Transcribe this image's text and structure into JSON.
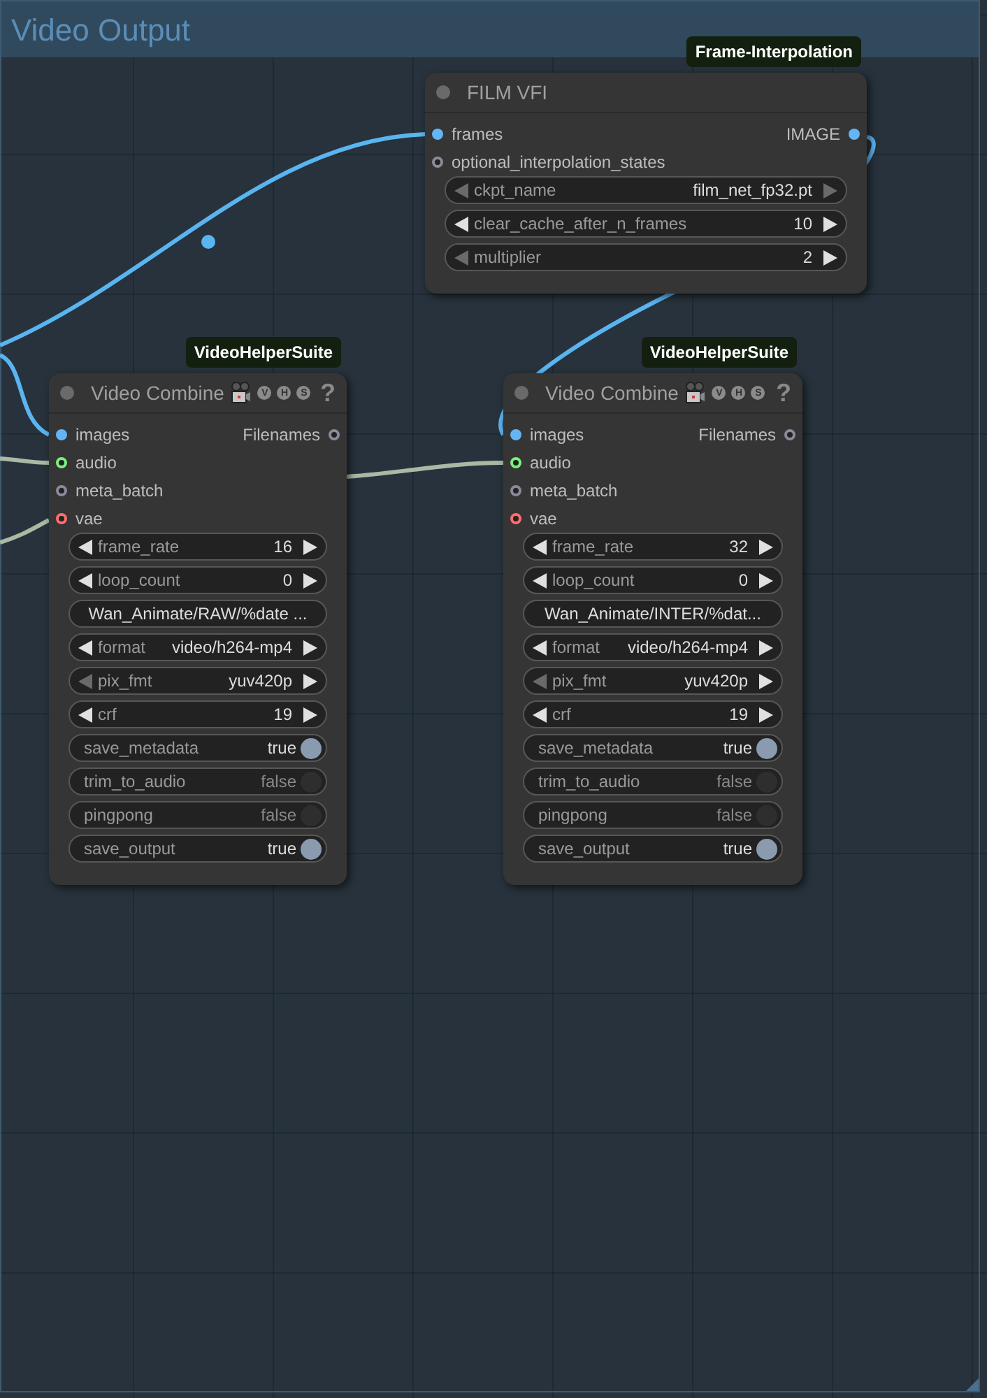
{
  "group": {
    "title": "Video Output"
  },
  "links": [
    {
      "color": "#5ab4f0"
    },
    {
      "color": "#5ab4f0"
    },
    {
      "color": "#5ab4f0"
    },
    {
      "color": "#a9b9a4"
    },
    {
      "color": "#a9b9a4"
    },
    {
      "color": "#a9b9a4"
    }
  ],
  "nodes": [
    {
      "badge": "Frame-Interpolation",
      "title": "FILM VFI",
      "camera": false,
      "inputs": [
        {
          "name": "frames",
          "color": "#64b5f6",
          "connected": true
        },
        {
          "name": "optional_interpolation_states",
          "color": "#8a8a9a",
          "connected": false
        }
      ],
      "outputs": [
        {
          "name": "IMAGE",
          "color": "#64b5f6",
          "connected": true
        }
      ],
      "widgets": [
        {
          "kind": "combo",
          "label": "ckpt_name",
          "value": "film_net_fp32.pt",
          "prev_enabled": false,
          "next_enabled": false
        },
        {
          "kind": "number",
          "label": "clear_cache_after_n_frames",
          "value": "10",
          "prev_enabled": true,
          "next_enabled": true
        },
        {
          "kind": "number",
          "label": "multiplier",
          "value": "2",
          "prev_enabled": false,
          "next_enabled": true
        }
      ]
    },
    {
      "badge": "VideoHelperSuite",
      "title": "Video Combine",
      "camera": true,
      "header_icons": [
        "V",
        "H",
        "S"
      ],
      "help": "?",
      "inputs": [
        {
          "name": "images",
          "color": "#64b5f6",
          "connected": true
        },
        {
          "name": "audio",
          "color": "#7cf07c",
          "connected": false
        },
        {
          "name": "meta_batch",
          "color": "#8a8a9a",
          "connected": false
        },
        {
          "name": "vae",
          "color": "#ff6e6e",
          "connected": false
        }
      ],
      "outputs": [
        {
          "name": "Filenames",
          "color": "#8a8a9a",
          "connected": false
        }
      ],
      "widgets": [
        {
          "kind": "number",
          "label": "frame_rate",
          "value": "16",
          "prev_enabled": true,
          "next_enabled": true
        },
        {
          "kind": "number",
          "label": "loop_count",
          "value": "0",
          "prev_enabled": true,
          "next_enabled": true
        },
        {
          "kind": "text",
          "value": "Wan_Animate/RAW/%date ..."
        },
        {
          "kind": "combo",
          "label": "format",
          "value": "video/h264-mp4",
          "prev_enabled": true,
          "next_enabled": true
        },
        {
          "kind": "combo",
          "label": "pix_fmt",
          "value": "yuv420p",
          "prev_enabled": false,
          "next_enabled": true
        },
        {
          "kind": "number",
          "label": "crf",
          "value": "19",
          "prev_enabled": true,
          "next_enabled": true
        },
        {
          "kind": "toggle",
          "label": "save_metadata",
          "value": "true",
          "on": true
        },
        {
          "kind": "toggle",
          "label": "trim_to_audio",
          "value": "false",
          "on": false
        },
        {
          "kind": "toggle",
          "label": "pingpong",
          "value": "false",
          "on": false
        },
        {
          "kind": "toggle",
          "label": "save_output",
          "value": "true",
          "on": true
        }
      ]
    },
    {
      "badge": "VideoHelperSuite",
      "title": "Video Combine",
      "camera": true,
      "header_icons": [
        "V",
        "H",
        "S"
      ],
      "help": "?",
      "inputs": [
        {
          "name": "images",
          "color": "#64b5f6",
          "connected": true
        },
        {
          "name": "audio",
          "color": "#7cf07c",
          "connected": false
        },
        {
          "name": "meta_batch",
          "color": "#8a8a9a",
          "connected": false
        },
        {
          "name": "vae",
          "color": "#ff6e6e",
          "connected": false
        }
      ],
      "outputs": [
        {
          "name": "Filenames",
          "color": "#8a8a9a",
          "connected": false
        }
      ],
      "widgets": [
        {
          "kind": "number",
          "label": "frame_rate",
          "value": "32",
          "prev_enabled": true,
          "next_enabled": true
        },
        {
          "kind": "number",
          "label": "loop_count",
          "value": "0",
          "prev_enabled": true,
          "next_enabled": true
        },
        {
          "kind": "text",
          "value": "Wan_Animate/INTER/%dat..."
        },
        {
          "kind": "combo",
          "label": "format",
          "value": "video/h264-mp4",
          "prev_enabled": true,
          "next_enabled": true
        },
        {
          "kind": "combo",
          "label": "pix_fmt",
          "value": "yuv420p",
          "prev_enabled": false,
          "next_enabled": true
        },
        {
          "kind": "number",
          "label": "crf",
          "value": "19",
          "prev_enabled": true,
          "next_enabled": true
        },
        {
          "kind": "toggle",
          "label": "save_metadata",
          "value": "true",
          "on": true
        },
        {
          "kind": "toggle",
          "label": "trim_to_audio",
          "value": "false",
          "on": false
        },
        {
          "kind": "toggle",
          "label": "pingpong",
          "value": "false",
          "on": false
        },
        {
          "kind": "toggle",
          "label": "save_output",
          "value": "true",
          "on": true
        }
      ]
    }
  ]
}
